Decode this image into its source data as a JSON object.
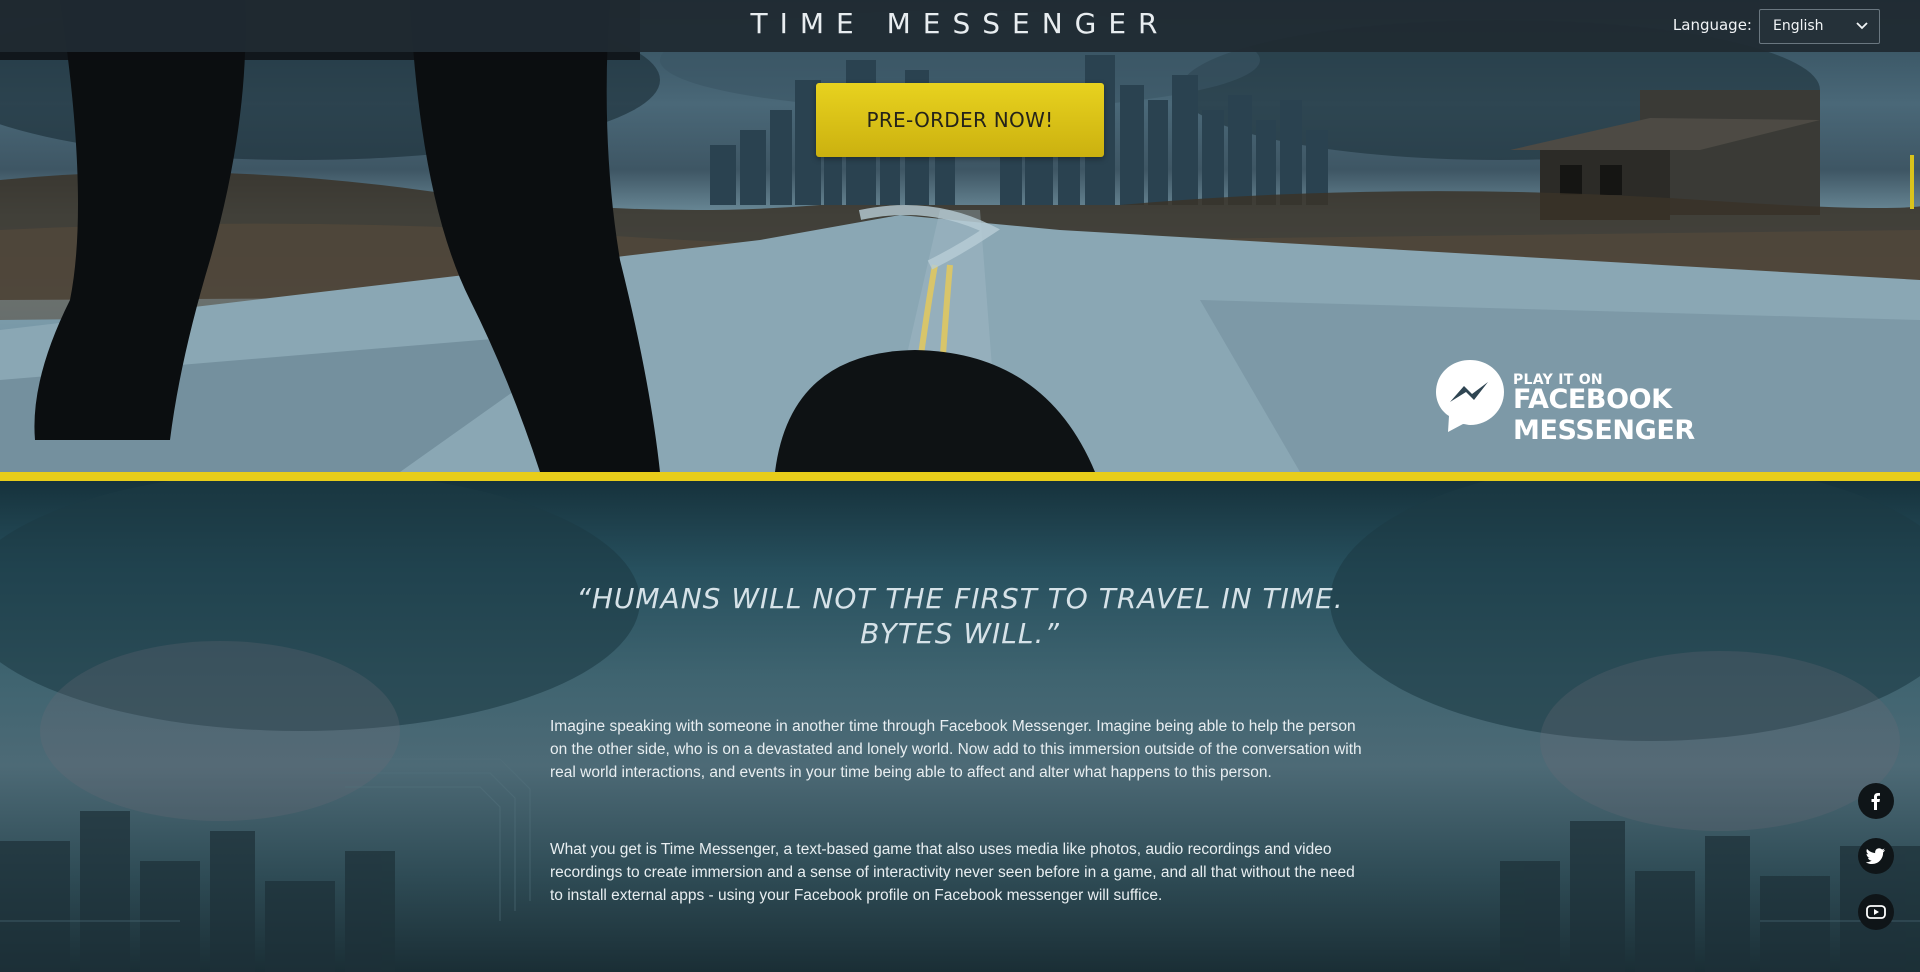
{
  "header": {
    "logo_text": "TIME MESSENGER",
    "language_label": "Language:",
    "language_value": "English"
  },
  "hero": {
    "preorder_label": "PRE-ORDER NOW!",
    "badge_small": "PLAY IT ON",
    "badge_big": "FACEBOOK MESSENGER"
  },
  "intro": {
    "quote_line1": "“HUMANS WILL NOT THE FIRST TO TRAVEL IN TIME.",
    "quote_line2": "BYTES WILL.”",
    "paragraph1": "Imagine speaking with someone in another time through Facebook Messenger. Imagine being able to help the person on the other side, who is on a devastated and lonely world. Now add to this immersion outside of the conversation with real world interactions, and events in your time being able to affect and alter what happens to this person.",
    "paragraph2": "What you get is Time Messenger, a text-based game that also uses media like photos, audio recordings and video recordings to create immersion and a sense of interactivity never seen before in a game, and all that without the need to install external apps - using your Facebook profile on Facebook messenger will suffice."
  },
  "social": {
    "facebook_icon": "facebook-icon",
    "twitter_icon": "twitter-icon",
    "youtube_icon": "youtube-icon"
  },
  "colors": {
    "accent_yellow": "#e8cd1a",
    "topbar": "#202a32",
    "text_light": "#e8eef1"
  }
}
